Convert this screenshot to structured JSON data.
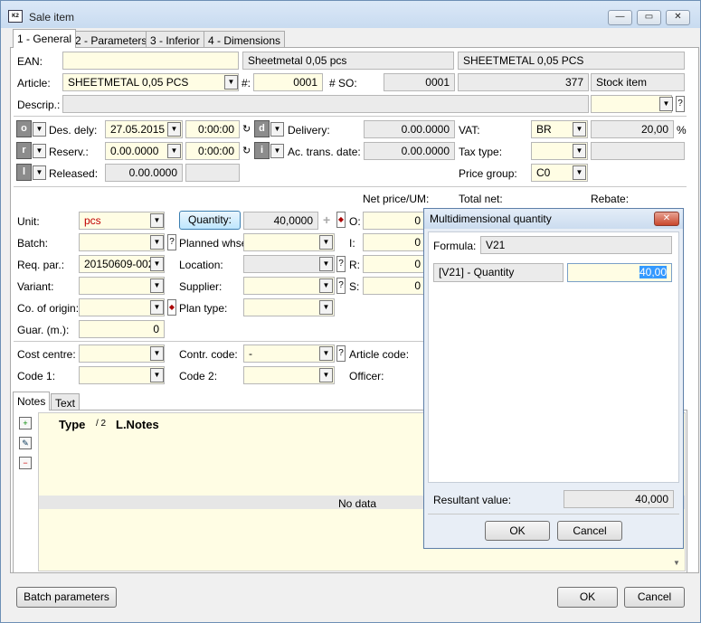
{
  "window": {
    "title": "Sale item",
    "minimize": "—",
    "restore": "▭",
    "close": "✕"
  },
  "tabs": [
    "1 - General",
    "2 - Parameters",
    "3 - Inferior",
    "4 - Dimensions"
  ],
  "header": {
    "ean_label": "EAN:",
    "ean_value": "",
    "ean_desc": "Sheetmetal 0,05 pcs",
    "ean_desc2": "SHEETMETAL 0,05 PCS",
    "article_label": "Article:",
    "article_value": "SHEETMETAL 0,05 PCS",
    "hash_label": "#:",
    "hash_value": "0001",
    "so_label": "# SO:",
    "so_value": "0001",
    "so_num": "377",
    "stock_item": "Stock item",
    "descrip_label": "Descrip.:"
  },
  "dates": {
    "des_dely_label": "Des. dely:",
    "des_dely_date": "27.05.2015",
    "des_dely_time": "0:00:00",
    "delivery_label": "Delivery:",
    "delivery_value": "0.00.0000",
    "vat_label": "VAT:",
    "vat_code": "BR",
    "vat_rate": "20,00",
    "vat_unit": "%",
    "reserv_label": "Reserv.:",
    "reserv_date": "0.00.0000",
    "reserv_time": "0:00:00",
    "ac_trans_label": "Ac. trans. date:",
    "ac_trans_value": "0.00.0000",
    "tax_type_label": "Tax type:",
    "released_label": "Released:",
    "released_value": "0.00.0000",
    "price_group_label": "Price group:",
    "price_group_value": "C0",
    "btn_o": "o",
    "btn_r": "r",
    "btn_l": "l",
    "btn_d": "d",
    "btn_i": "i"
  },
  "item": {
    "net_price_label": "Net price/UM:",
    "total_net_label": "Total net:",
    "rebate_label": "Rebate:",
    "unit_label": "Unit:",
    "unit_value": "pcs",
    "quantity_button": "Quantity:",
    "quantity_value": "40,0000",
    "o_label": "O:",
    "i_label": "I:",
    "r_label": "R:",
    "s_label": "S:",
    "zero": "0",
    "batch_label": "Batch:",
    "planned_whse_label": "Planned whse:",
    "req_par_label": "Req. par.:",
    "req_par_value": "20150609-002",
    "location_label": "Location:",
    "variant_label": "Variant:",
    "supplier_label": "Supplier:",
    "co_origin_label": "Co. of origin:",
    "plan_type_label": "Plan type:",
    "guar_label": "Guar. (m.):",
    "guar_value": "0"
  },
  "cost": {
    "cost_centre_label": "Cost centre:",
    "contr_code_label": "Contr. code:",
    "contr_code_value": "-",
    "article_code_label": "Article code:",
    "code1_label": "Code 1:",
    "code2_label": "Code 2:",
    "officer_label": "Officer:"
  },
  "notes": {
    "tab_notes": "Notes",
    "tab_text": "Text",
    "col_type": "Type",
    "col_l": "/ 2",
    "col_notes": "L.Notes",
    "no_data": "No data"
  },
  "footer": {
    "batch_params": "Batch parameters",
    "ok": "OK",
    "cancel": "Cancel"
  },
  "dialog": {
    "title": "Multidimensional quantity",
    "close": "✕",
    "formula_label": "Formula:",
    "formula_value": "V21",
    "row_label": "[V21] - Quantity",
    "row_value": "40,00",
    "resultant_label": "Resultant value:",
    "resultant_value": "40,000",
    "ok": "OK",
    "cancel": "Cancel"
  }
}
